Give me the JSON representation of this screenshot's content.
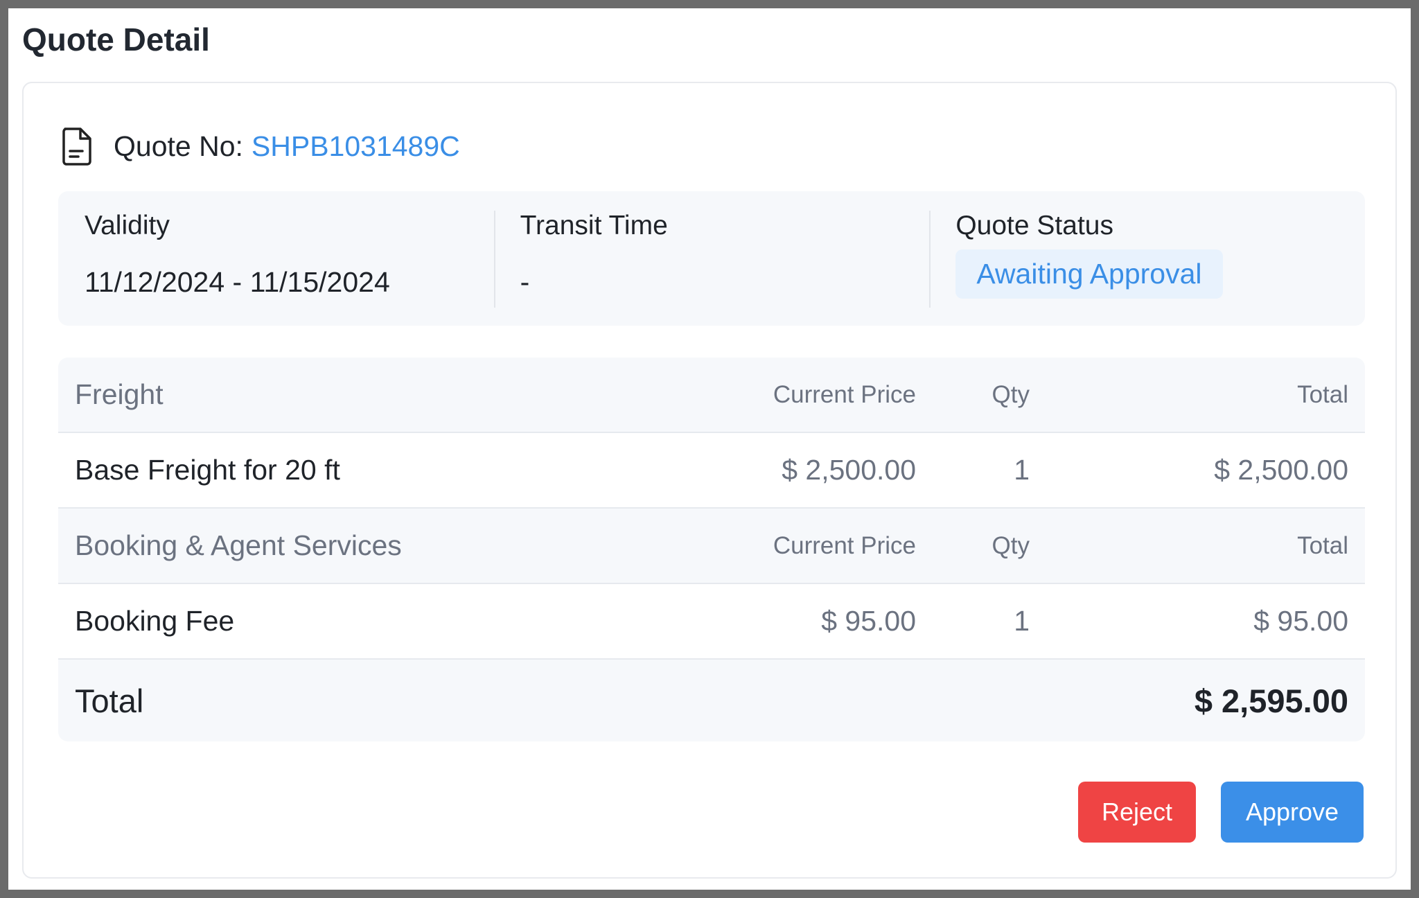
{
  "page": {
    "title": "Quote Detail"
  },
  "quote": {
    "label": "Quote No:",
    "number": "SHPB1031489C"
  },
  "info": {
    "validity": {
      "label": "Validity",
      "value": "11/12/2024 - 11/15/2024"
    },
    "transit": {
      "label": "Transit Time",
      "value": "-"
    },
    "status": {
      "label": "Quote Status",
      "value": "Awaiting Approval"
    }
  },
  "sections": [
    {
      "name": "Freight",
      "headers": {
        "price": "Current Price",
        "qty": "Qty",
        "total": "Total"
      },
      "items": [
        {
          "name": "Base Freight for 20 ft",
          "price": "$ 2,500.00",
          "qty": "1",
          "total": "$ 2,500.00"
        }
      ]
    },
    {
      "name": "Booking & Agent Services",
      "headers": {
        "price": "Current Price",
        "qty": "Qty",
        "total": "Total"
      },
      "items": [
        {
          "name": "Booking Fee",
          "price": "$ 95.00",
          "qty": "1",
          "total": "$ 95.00"
        }
      ]
    }
  ],
  "summary": {
    "label": "Total",
    "value": "$ 2,595.00"
  },
  "actions": {
    "reject": "Reject",
    "approve": "Approve"
  },
  "colors": {
    "accent": "#3a8ee6",
    "reject": "#ef4444",
    "approve": "#3b8fe8",
    "status_bg": "#e8f2fd"
  },
  "icons": {
    "quote": "document-icon"
  }
}
